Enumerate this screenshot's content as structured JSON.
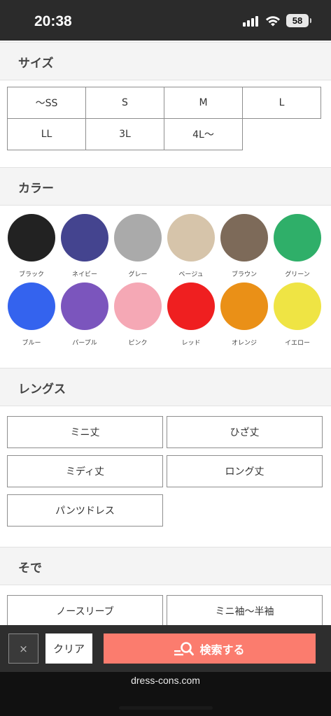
{
  "status": {
    "time": "20:38",
    "battery": "58"
  },
  "sections": {
    "size": {
      "title": "サイズ",
      "options": [
        "〜SS",
        "S",
        "M",
        "L",
        "LL",
        "3L",
        "4L〜"
      ]
    },
    "color": {
      "title": "カラー",
      "options": [
        {
          "label": "ブラック",
          "color": "#222222"
        },
        {
          "label": "ネイビー",
          "color": "#44448f"
        },
        {
          "label": "グレー",
          "color": "#aaaaaa"
        },
        {
          "label": "ベージュ",
          "color": "#d6c4aa"
        },
        {
          "label": "ブラウン",
          "color": "#7d6a59"
        },
        {
          "label": "グリーン",
          "color": "#2faf69"
        },
        {
          "label": "ブルー",
          "color": "#3463ee"
        },
        {
          "label": "パープル",
          "color": "#7b55bd"
        },
        {
          "label": "ピンク",
          "color": "#f5a8b5"
        },
        {
          "label": "レッド",
          "color": "#ef1f20"
        },
        {
          "label": "オレンジ",
          "color": "#ea9017"
        },
        {
          "label": "イエロー",
          "color": "#efe444"
        }
      ]
    },
    "length": {
      "title": "レングス",
      "options": [
        "ミニ丈",
        "ひざ丈",
        "ミディ丈",
        "ロング丈",
        "パンツドレス"
      ]
    },
    "sleeve": {
      "title": "そで",
      "options": [
        "ノースリーブ",
        "ミニ袖〜半袖"
      ]
    }
  },
  "bottom_bar": {
    "close": "×",
    "clear": "クリア",
    "search": "検索する"
  },
  "browser": {
    "url": "dress-cons.com"
  }
}
